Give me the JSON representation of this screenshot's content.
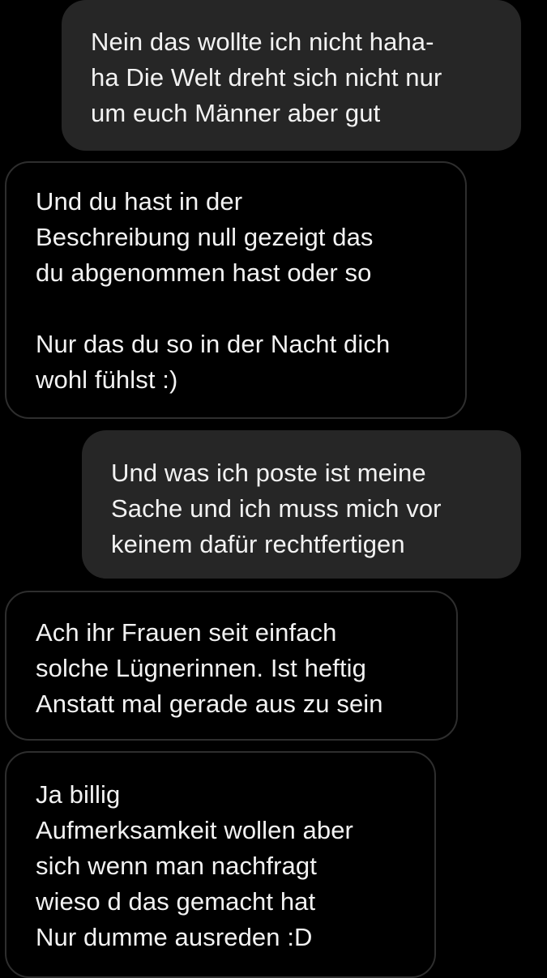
{
  "conversation": {
    "messages": [
      {
        "direction": "sent",
        "text": "Nein das wollte ich nicht haha-\nha Die Welt dreht sich nicht nur\num euch Männer aber gut"
      },
      {
        "direction": "received",
        "text": "Und du hast in der\nBeschreibung null gezeigt das\ndu abgenommen hast oder so\n\nNur das du so in der Nacht dich\nwohl fühlst :)"
      },
      {
        "direction": "sent",
        "text": "Und was ich poste ist meine\nSache und ich muss mich vor\nkeinem dafür rechtfertigen"
      },
      {
        "direction": "received",
        "text": "Ach ihr Frauen seit einfach\nsolche Lügnerinnen. Ist heftig\nAnstatt mal gerade aus zu sein"
      },
      {
        "direction": "received",
        "text": "Ja billig\nAufmerksamkeit wollen aber\nsich wenn man nachfragt\nwieso d das gemacht hat\nNur dumme ausreden :D"
      }
    ]
  },
  "colors": {
    "background": "#000000",
    "sent_bubble": "#262626",
    "received_border": "#2e2e2e",
    "text": "#f2f2f2"
  }
}
